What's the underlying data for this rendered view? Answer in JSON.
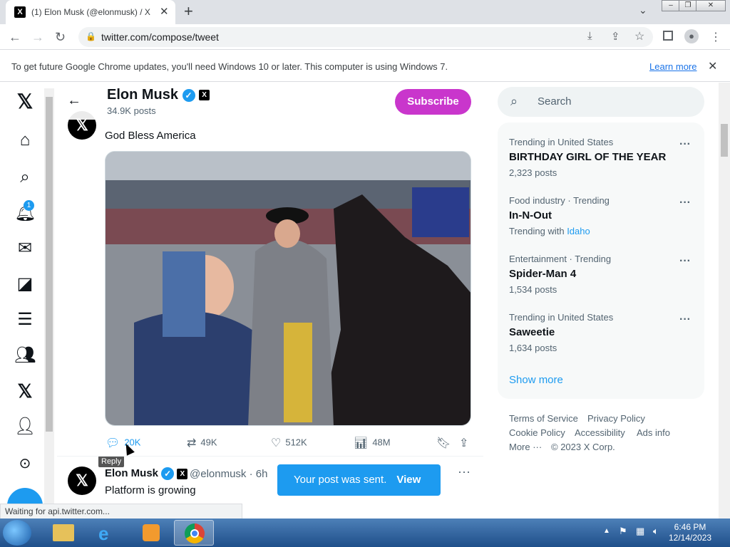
{
  "browser": {
    "tab_title": "(1) Elon Musk (@elonmusk) / X",
    "tab_favicon": "X",
    "url": "twitter.com/compose/tweet",
    "infobar_message": "To get future Google Chrome updates, you'll need Windows 10 or later. This computer is using Windows 7.",
    "infobar_link": "Learn more",
    "status_text": "Waiting for api.twitter.com..."
  },
  "header": {
    "name": "Elon Musk",
    "post_count": "34.9K posts",
    "subscribe_label": "Subscribe"
  },
  "nav": {
    "notifications_badge": "1"
  },
  "tweet1": {
    "text": "God Bless America",
    "replies": "20K",
    "reposts": "49K",
    "likes": "512K",
    "views": "48M",
    "tooltip": "Reply"
  },
  "tweet2": {
    "name": "Elon Musk",
    "handle_time": "@elonmusk · 6h",
    "text": "Platform is growing"
  },
  "toast": {
    "message": "Your post was sent.",
    "action": "View"
  },
  "search": {
    "placeholder": "Search"
  },
  "trends": [
    {
      "context": "Trending in United States",
      "topic": "BIRTHDAY GIRL OF THE YEAR",
      "sub": "2,323 posts"
    },
    {
      "context": "Food industry · Trending",
      "topic": "In-N-Out",
      "sub": "Trending with",
      "sub_link": "Idaho"
    },
    {
      "context": "Entertainment · Trending",
      "topic": "Spider-Man 4",
      "sub": "1,534 posts"
    },
    {
      "context": "Trending in United States",
      "topic": "Saweetie",
      "sub": "1,634 posts"
    }
  ],
  "show_more": "Show more",
  "footer": {
    "terms": "Terms of Service",
    "privacy": "Privacy Policy",
    "cookie": "Cookie Policy",
    "accessibility": "Accessibility",
    "ads": "Ads info",
    "more": "More ···",
    "copyright": "© 2023 X Corp."
  },
  "taskbar": {
    "time": "6:46 PM",
    "date": "12/14/2023"
  },
  "colors": {
    "accent": "#1d9bf0",
    "subscribe": "#c936cc"
  }
}
